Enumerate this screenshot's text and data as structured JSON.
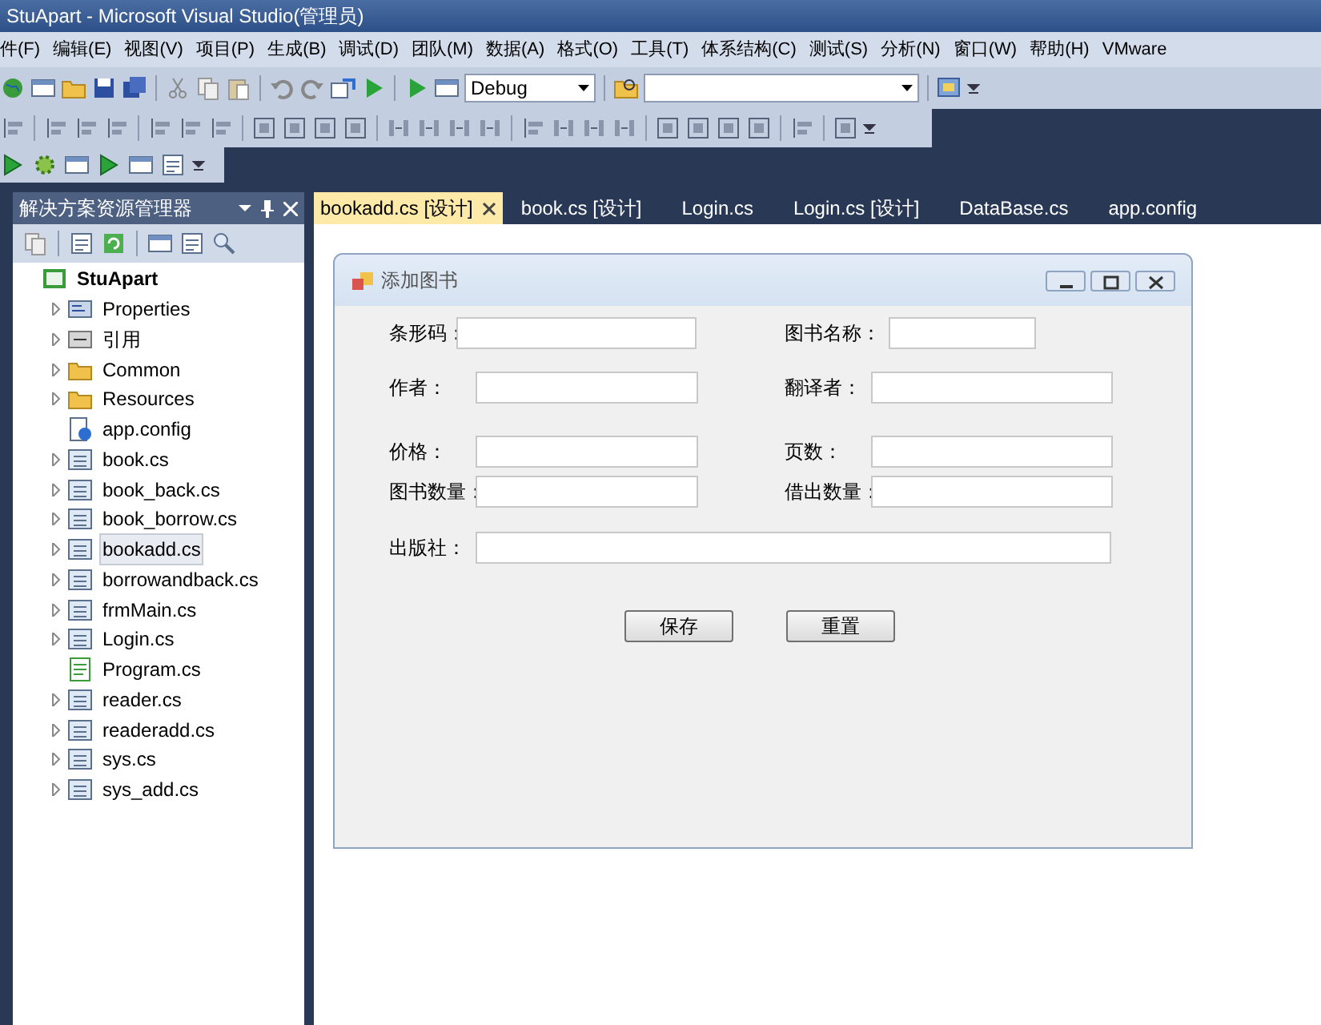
{
  "window": {
    "title": "StuApart - Microsoft Visual Studio(管理员)"
  },
  "menu": [
    "件(F)",
    "编辑(E)",
    "视图(V)",
    "项目(P)",
    "生成(B)",
    "调试(D)",
    "团队(M)",
    "数据(A)",
    "格式(O)",
    "工具(T)",
    "体系结构(C)",
    "测试(S)",
    "分析(N)",
    "窗口(W)",
    "帮助(H)",
    "VMware"
  ],
  "toolbar": {
    "configuration": "Debug"
  },
  "solution_explorer": {
    "title": "解决方案资源管理器",
    "tree": [
      {
        "label": "StuApart",
        "kind": "project",
        "expandable": false,
        "selected": false,
        "children": [
          {
            "label": "Properties",
            "kind": "properties",
            "expandable": true,
            "selected": false
          },
          {
            "label": "引用",
            "kind": "references",
            "expandable": true,
            "selected": false
          },
          {
            "label": "Common",
            "kind": "folder",
            "expandable": true,
            "selected": false
          },
          {
            "label": "Resources",
            "kind": "folder",
            "expandable": true,
            "selected": false
          },
          {
            "label": "app.config",
            "kind": "config",
            "expandable": false,
            "selected": false
          },
          {
            "label": "book.cs",
            "kind": "form",
            "expandable": true,
            "selected": false
          },
          {
            "label": "book_back.cs",
            "kind": "form",
            "expandable": true,
            "selected": false
          },
          {
            "label": "book_borrow.cs",
            "kind": "form",
            "expandable": true,
            "selected": false
          },
          {
            "label": "bookadd.cs",
            "kind": "form",
            "expandable": true,
            "selected": true
          },
          {
            "label": "borrowandback.cs",
            "kind": "form",
            "expandable": true,
            "selected": false
          },
          {
            "label": "frmMain.cs",
            "kind": "form",
            "expandable": true,
            "selected": false
          },
          {
            "label": "Login.cs",
            "kind": "form",
            "expandable": true,
            "selected": false
          },
          {
            "label": "Program.cs",
            "kind": "code",
            "expandable": false,
            "selected": false
          },
          {
            "label": "reader.cs",
            "kind": "form",
            "expandable": true,
            "selected": false
          },
          {
            "label": "readeradd.cs",
            "kind": "form",
            "expandable": true,
            "selected": false
          },
          {
            "label": "sys.cs",
            "kind": "form",
            "expandable": true,
            "selected": false
          },
          {
            "label": "sys_add.cs",
            "kind": "form",
            "expandable": true,
            "selected": false
          }
        ]
      }
    ]
  },
  "tabs": [
    {
      "label": "bookadd.cs [设计]",
      "selected": true
    },
    {
      "label": "book.cs [设计]",
      "selected": false
    },
    {
      "label": "Login.cs",
      "selected": false
    },
    {
      "label": "Login.cs [设计]",
      "selected": false
    },
    {
      "label": "DataBase.cs",
      "selected": false
    },
    {
      "label": "app.config",
      "selected": false
    }
  ],
  "form": {
    "title": "添加图书",
    "fields": [
      {
        "label": "条形码："
      },
      {
        "label": "图书名称："
      },
      {
        "label": "作者："
      },
      {
        "label": "翻译者："
      },
      {
        "label": "价格："
      },
      {
        "label": "页数："
      },
      {
        "label": "图书数量："
      },
      {
        "label": "借出数量："
      },
      {
        "label": "出版社："
      }
    ],
    "buttons": [
      "保存",
      "重置"
    ]
  }
}
